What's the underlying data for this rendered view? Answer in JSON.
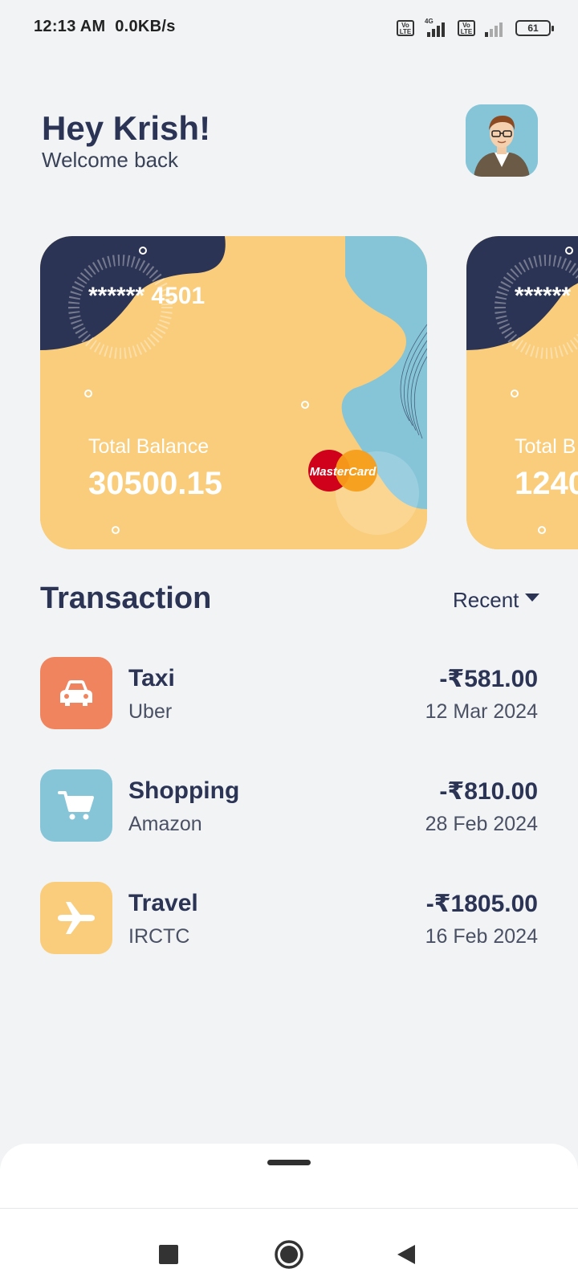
{
  "status_bar": {
    "time": "12:13 AM",
    "speed": "0.0KB/s",
    "network_label": "4G",
    "volte_label": "Vo LTE",
    "battery": "61"
  },
  "header": {
    "greeting": "Hey Krish!",
    "subtitle": "Welcome back"
  },
  "cards": [
    {
      "masked_number": "****** 4501",
      "balance_label": "Total Balance",
      "balance": "30500.15",
      "brand": "MasterCard"
    },
    {
      "masked_number": "****** ",
      "balance_label": "Total B",
      "balance": "1240"
    }
  ],
  "transactions_section": {
    "title": "Transaction",
    "filter": "Recent"
  },
  "transactions": [
    {
      "title": "Taxi",
      "merchant": "Uber",
      "amount": "-₹581.00",
      "date": "12 Mar 2024",
      "icon": "car-icon",
      "color": "#f0845f"
    },
    {
      "title": "Shopping",
      "merchant": "Amazon",
      "amount": "-₹810.00",
      "date": "28 Feb 2024",
      "icon": "cart-icon",
      "color": "#86c5d8"
    },
    {
      "title": "Travel",
      "merchant": "IRCTC",
      "amount": "-₹1805.00",
      "date": "16 Feb 2024",
      "icon": "airplane-icon",
      "color": "#f9cd7b"
    }
  ],
  "colors": {
    "navy": "#2b3454",
    "card_yellow": "#f9cd7b",
    "card_blue": "#86c5d8",
    "taxi_orange": "#f0845f",
    "background": "#f1f3f5"
  }
}
